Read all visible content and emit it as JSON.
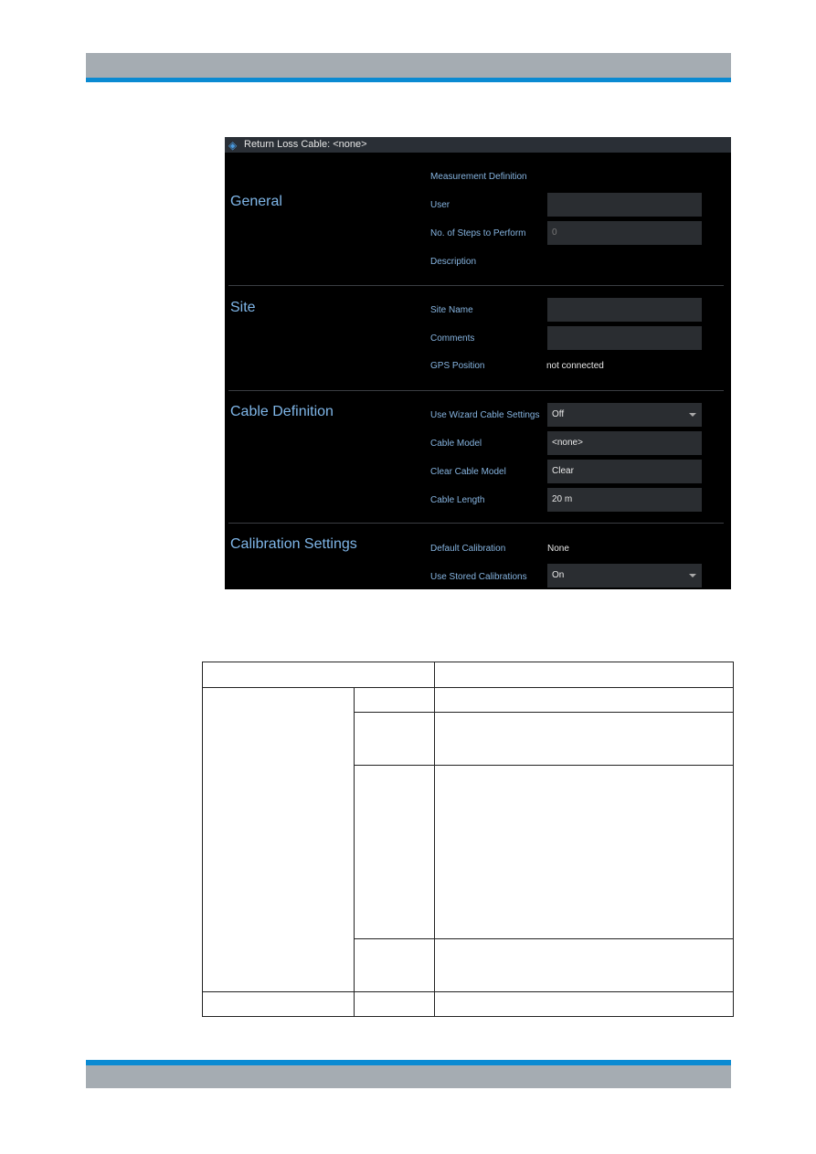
{
  "screenshot": {
    "title": "Return Loss  Cable: <none>",
    "sections": [
      {
        "title": "General",
        "rows": [
          {
            "label": "Measurement Definition"
          },
          {
            "label": "User",
            "value": ""
          },
          {
            "label": "No. of Steps to Perform",
            "value": "0"
          },
          {
            "label": "Description"
          }
        ]
      },
      {
        "title": "Site",
        "rows": [
          {
            "label": "Site Name",
            "value": ""
          },
          {
            "label": "Comments",
            "value": ""
          },
          {
            "label": "GPS Position",
            "value": "not connected"
          }
        ]
      },
      {
        "title": "Cable Definition",
        "rows": [
          {
            "label": "Use Wizard Cable Settings",
            "value": "Off"
          },
          {
            "label": "Cable Model",
            "value": "<none>"
          },
          {
            "label": "Clear Cable Model",
            "value": "Clear"
          },
          {
            "label": "Cable Length",
            "value": "20 m"
          }
        ]
      },
      {
        "title": "Calibration Settings",
        "rows": [
          {
            "label": "Default Calibration",
            "value": "None"
          },
          {
            "label": "Use Stored Calibrations",
            "value": "On"
          }
        ]
      }
    ]
  },
  "colors": {
    "accent": "#0a8ad2",
    "header_gray": "#a5acb2",
    "label_blue": "#86b4e0"
  }
}
